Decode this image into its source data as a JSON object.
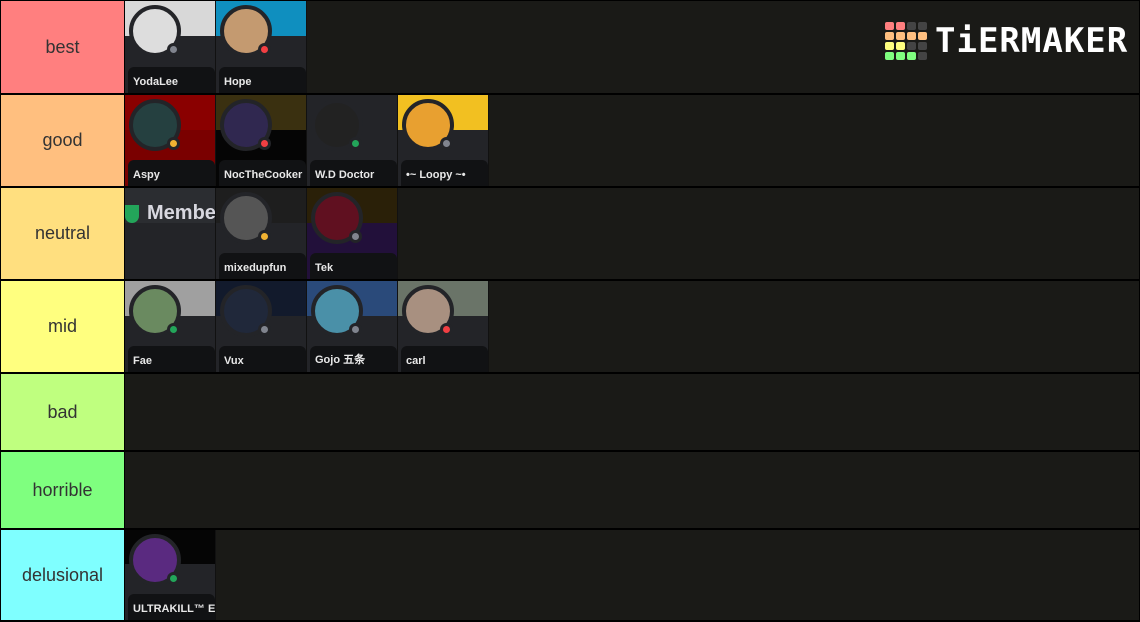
{
  "logo": {
    "text": "TiERMAKER",
    "grid": [
      "#ff7f7f",
      "#ff7f7f",
      "#444",
      "#444",
      "#ffbf7f",
      "#ffbf7f",
      "#ffbf7f",
      "#ffbf7f",
      "#ffff7f",
      "#ffff7f",
      "#444",
      "#444",
      "#7fff7f",
      "#7fff7f",
      "#7fff7f",
      "#444"
    ]
  },
  "tiers": [
    {
      "label": "best",
      "color": "#ff7f7f",
      "items": [
        {
          "name": "YodaLee",
          "banner": "#d8d8d8",
          "avatar": "#ddd",
          "status": "offline"
        },
        {
          "name": "Hope",
          "banner": "#0f8fbf",
          "avatar": "#c49a70",
          "status": "dnd"
        }
      ]
    },
    {
      "label": "good",
      "color": "#ffbf7f",
      "items": [
        {
          "name": "Aspy",
          "banner": "#8a0000",
          "avatar": "#254040",
          "status": "idle",
          "bg": "#7a0000"
        },
        {
          "name": "NocTheCooker",
          "banner": "#3a3010",
          "avatar": "#302850",
          "status": "dnd",
          "bg": "#050505"
        },
        {
          "name": "W.D Doctor",
          "banner": "#232428",
          "avatar": "#222",
          "status": "online"
        },
        {
          "name": "•~ Loopy ~•",
          "banner": "#f2c021",
          "avatar": "#e8a030",
          "status": "offline"
        }
      ]
    },
    {
      "label": "neutral",
      "color": "#ffdf7f",
      "items": [
        {
          "name": "",
          "member": "Member",
          "banner": "#2b2d31",
          "avatar": "",
          "status": ""
        },
        {
          "name": "mixedupfun",
          "banner": "#1e1e1e",
          "avatar": "#555",
          "status": "idle"
        },
        {
          "name": "Tek",
          "banner": "#2a2008",
          "avatar": "#601020",
          "status": "offline",
          "bg": "#22103a"
        }
      ]
    },
    {
      "label": "mid",
      "color": "#ffff7f",
      "items": [
        {
          "name": "Fae",
          "banner": "#a0a0a0",
          "avatar": "#6a8a60",
          "status": "online"
        },
        {
          "name": "Vux",
          "banner": "#121a2c",
          "avatar": "#20283a",
          "status": "offline"
        },
        {
          "name": "Gojo 五条",
          "banner": "#2a4a7a",
          "avatar": "#4a90a8",
          "status": "offline"
        },
        {
          "name": "carl",
          "banner": "#6a7468",
          "avatar": "#a89080",
          "status": "dnd"
        }
      ]
    },
    {
      "label": "bad",
      "color": "#bfff7f",
      "items": []
    },
    {
      "label": "horrible",
      "color": "#7fff7f",
      "items": []
    },
    {
      "label": "delusional",
      "color": "#7fffff",
      "items": [
        {
          "name": "ULTRAKILL™ Enthu",
          "banner": "#050505",
          "avatar": "#5a2a80",
          "status": "online"
        }
      ]
    }
  ],
  "status_colors": {
    "online": "#23a55a",
    "idle": "#f0b232",
    "dnd": "#f23f43",
    "offline": "#80848e"
  }
}
